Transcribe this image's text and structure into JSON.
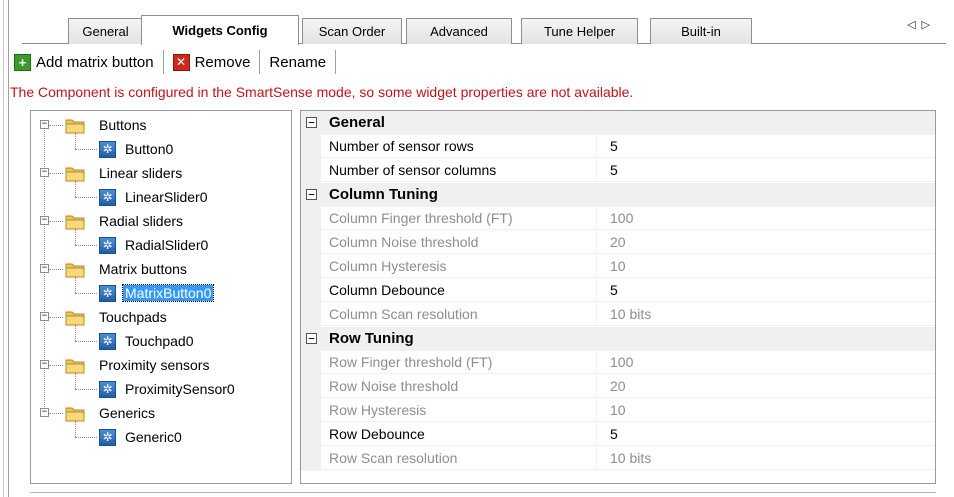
{
  "tabs": [
    {
      "label": "General",
      "active": false
    },
    {
      "label": "Widgets Config",
      "active": true
    },
    {
      "label": "Scan Order",
      "active": false
    },
    {
      "label": "Advanced",
      "active": false
    },
    {
      "label": "Tune Helper",
      "active": false
    },
    {
      "label": "Built-in",
      "active": false
    }
  ],
  "tab_scroll": {
    "left": "◁",
    "right": "▷"
  },
  "toolbar": {
    "add_label": "Add matrix button",
    "add_icon": "plus-icon",
    "remove_label": "Remove",
    "remove_icon": "remove-x-icon",
    "rename_label": "Rename"
  },
  "notice": "The Component is configured in the SmartSense mode, so some widget properties are not available.",
  "tree": {
    "groups": [
      {
        "label": "Buttons",
        "child": "Button0"
      },
      {
        "label": "Linear sliders",
        "child": "LinearSlider0"
      },
      {
        "label": "Radial sliders",
        "child": "RadialSlider0"
      },
      {
        "label": "Matrix buttons",
        "child": "MatrixButton0"
      },
      {
        "label": "Touchpads",
        "child": "Touchpad0"
      },
      {
        "label": "Proximity sensors",
        "child": "ProximitySensor0"
      },
      {
        "label": "Generics",
        "child": "Generic0"
      }
    ],
    "selected": "MatrixButton0"
  },
  "grid": {
    "categories": [
      {
        "name": "General",
        "properties": [
          {
            "name": "Number of sensor rows",
            "value": "5",
            "enabled": true
          },
          {
            "name": "Number of sensor columns",
            "value": "5",
            "enabled": true
          }
        ]
      },
      {
        "name": "Column Tuning",
        "properties": [
          {
            "name": "Column Finger threshold (FT)",
            "value": "100",
            "enabled": false
          },
          {
            "name": "Column Noise threshold",
            "value": "20",
            "enabled": false
          },
          {
            "name": "Column Hysteresis",
            "value": "10",
            "enabled": false
          },
          {
            "name": "Column Debounce",
            "value": "5",
            "enabled": true
          },
          {
            "name": "Column Scan resolution",
            "value": "10 bits",
            "enabled": false
          }
        ]
      },
      {
        "name": "Row Tuning",
        "properties": [
          {
            "name": "Row Finger threshold (FT)",
            "value": "100",
            "enabled": false
          },
          {
            "name": "Row Noise threshold",
            "value": "20",
            "enabled": false
          },
          {
            "name": "Row Hysteresis",
            "value": "10",
            "enabled": false
          },
          {
            "name": "Row Debounce",
            "value": "5",
            "enabled": true
          },
          {
            "name": "Row Scan resolution",
            "value": "10 bits",
            "enabled": false
          }
        ]
      }
    ]
  },
  "colors": {
    "notice": "#c0141a",
    "selection": "#3399ff",
    "disabled_text": "#8d8d8d",
    "category_bg": "#f0f0f0"
  }
}
